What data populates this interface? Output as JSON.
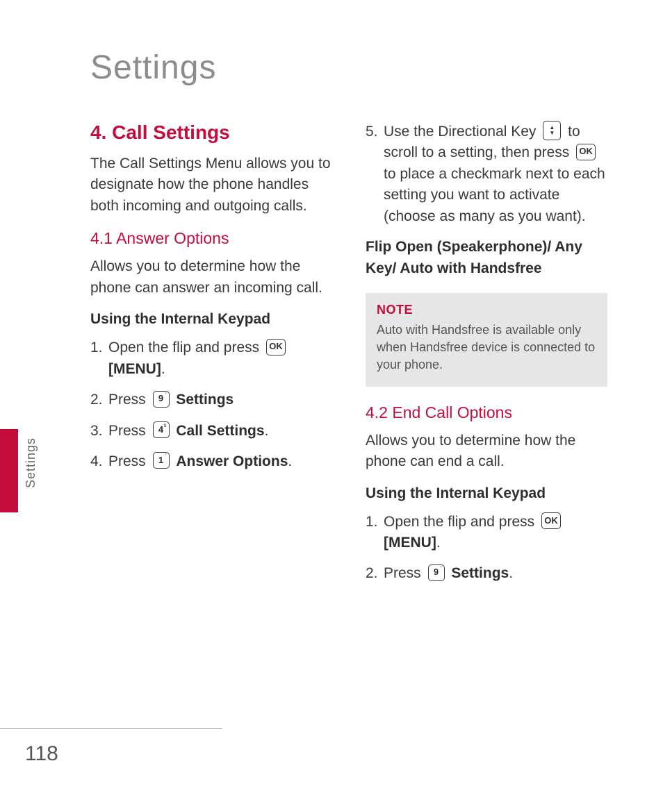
{
  "pageTitle": "Settings",
  "sideLabel": "Settings",
  "pageNumber": "118",
  "left": {
    "h1": "4. Call Settings",
    "intro": "The Call Settings Menu allows you to designate how the phone handles both incoming and outgoing calls.",
    "h2": "4.1 Answer Options",
    "desc": "Allows you to determine how the phone can answer an incoming call.",
    "stepHeading": "Using the Internal Keypad",
    "s1a": "Open the flip and press ",
    "s1b": "[MENU]",
    "s1c": ".",
    "s2a": "Press ",
    "s2b": "Settings",
    "s3a": "Press ",
    "s3b": "Call Settings",
    "s3c": ".",
    "s4a": "Press ",
    "s4b": "Answer Options",
    "s4c": "."
  },
  "right": {
    "s5a": "Use the Directional Key ",
    "s5b": " to scroll to a setting, then press ",
    "s5c": " to place a checkmark next to each setting you want to activate (choose as many as you want).",
    "options": "Flip Open (Speakerphone)/ Any Key/ Auto with Handsfree",
    "noteTitle": "NOTE",
    "noteBody": "Auto with Handsfree is available only when Handsfree device is connected to your phone.",
    "h2": "4.2 End Call Options",
    "desc": "Allows you to determine how the phone can end a call.",
    "stepHeading": "Using the Internal Keypad",
    "s1a": "Open the flip and press ",
    "s1b": "[MENU]",
    "s1c": ".",
    "s2a": "Press ",
    "s2b": "Settings",
    "s2c": "."
  },
  "keys": {
    "ok": "OK",
    "k9": "9",
    "k4": "4",
    "k1": "1"
  }
}
